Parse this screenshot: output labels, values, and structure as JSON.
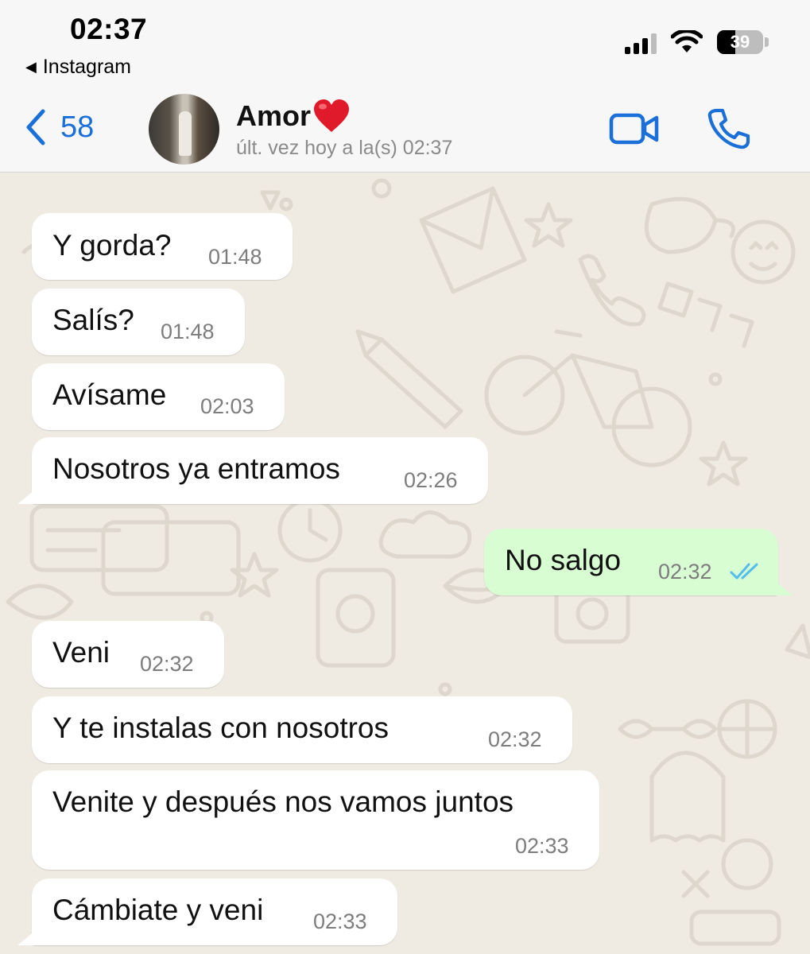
{
  "status_bar": {
    "time": "02:37",
    "back_app": "Instagram",
    "battery": "39",
    "battery_level": 0.39
  },
  "header": {
    "unread_count": "58",
    "contact_name": "Amor",
    "contact_emoji": "heart-emoji",
    "last_seen": "últ. vez hoy a la(s) 02:37",
    "icons": [
      "chevron-left-icon",
      "video-call-icon",
      "phone-icon"
    ],
    "accent": "#1a73e8"
  },
  "messages": [
    {
      "text": "Y gorda?",
      "time": "01:48",
      "direction": "incoming"
    },
    {
      "text": "Salís?",
      "time": "01:48",
      "direction": "incoming"
    },
    {
      "text": "Avísame",
      "time": "02:03",
      "direction": "incoming"
    },
    {
      "text": "Nosotros ya entramos",
      "time": "02:26",
      "direction": "incoming"
    },
    {
      "text": "No salgo",
      "time": "02:32",
      "direction": "outgoing",
      "status": "read"
    },
    {
      "text": "Veni",
      "time": "02:32",
      "direction": "incoming"
    },
    {
      "text": "Y te instalas con nosotros",
      "time": "02:32",
      "direction": "incoming"
    },
    {
      "text": "Venite y después nos vamos juntos",
      "time": "02:33",
      "direction": "incoming"
    },
    {
      "text": "Cámbiate y veni",
      "time": "02:33",
      "direction": "incoming"
    }
  ],
  "colors": {
    "incoming_bubble": "#ffffff",
    "outgoing_bubble": "#d9fdd3",
    "chat_background": "#efeae2",
    "read_ticks": "#53bdeb"
  }
}
